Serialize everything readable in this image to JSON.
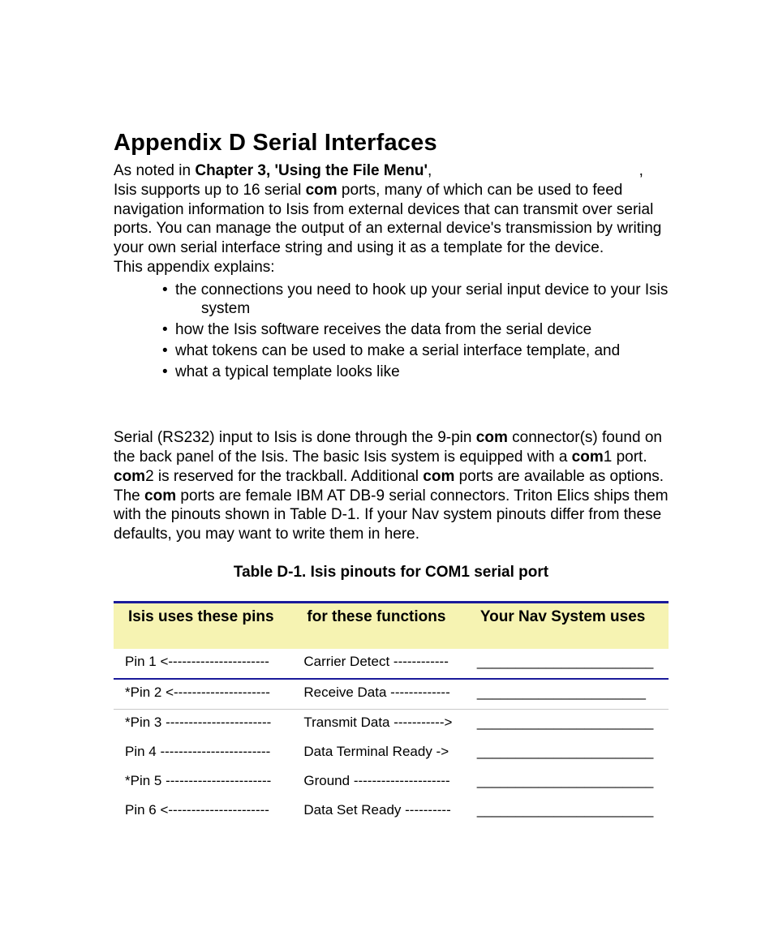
{
  "title": "Appendix D Serial Interfaces",
  "intro": {
    "line1_a": "As noted in ",
    "line1_b_bold": "Chapter 3, 'Using the File Menu'",
    "line1_c": ",",
    "line1_trailing_comma": ",",
    "line2_a": "Isis supports up to 16 serial ",
    "line2_b_bold": "com",
    "line2_c": " ports, many of which can be used to feed navigation information to Isis from external devices that can transmit over serial ports. You can manage the output of an external device's transmission by writing your own serial interface string and using it as a template for the device.",
    "line3": "This appendix explains:"
  },
  "bullets": [
    {
      "text": "the connections you need to hook up your serial input device to your Isis",
      "text2": "system"
    },
    {
      "text": "how the Isis software receives the data from the serial device"
    },
    {
      "text": "what tokens can be used to make a serial interface template, and"
    },
    {
      "text": "what a typical template looks like"
    }
  ],
  "para2": {
    "a": "Serial (RS232) input to Isis is done through the 9-pin ",
    "b_bold": "com",
    "c": " connector(s) found on the back panel of the Isis. The basic Isis system is equipped with a ",
    "d_bold": "com",
    "e": "1 port. ",
    "f_bold": "com",
    "g": "2 is reserved for the trackball. Additional ",
    "h_bold": "com",
    "i": " ports are available as options. The ",
    "j_bold": "com",
    "k": " ports are female IBM AT DB-9 serial connectors. Triton Elics ships them with the pinouts shown in Table D-1. If your Nav system pinouts differ from these defaults, you may want to write them in here."
  },
  "table_caption": "Table D-1. Isis pinouts for COM1 serial port",
  "table": {
    "headers": [
      "Isis uses these pins",
      "for these functions",
      "Your Nav System uses"
    ],
    "rows": [
      {
        "pin": "Pin 1 <----------------------",
        "func": "Carrier Detect ------------",
        "nav": "_______________________"
      },
      {
        "pin": "*Pin 2 <---------------------",
        "func": "Receive Data -------------",
        "nav": "______________________"
      },
      {
        "pin": "*Pin 3 -----------------------",
        "func": "Transmit Data ----------->",
        "nav": "_______________________"
      },
      {
        "pin": "Pin 4 ------------------------",
        "func": "Data Terminal Ready ->",
        "nav": "_______________________"
      },
      {
        "pin": "*Pin 5 -----------------------",
        "func": "Ground ---------------------",
        "nav": "_______________________"
      },
      {
        "pin": "Pin 6 <----------------------",
        "func": "Data Set Ready ----------",
        "nav": "_______________________"
      }
    ]
  }
}
